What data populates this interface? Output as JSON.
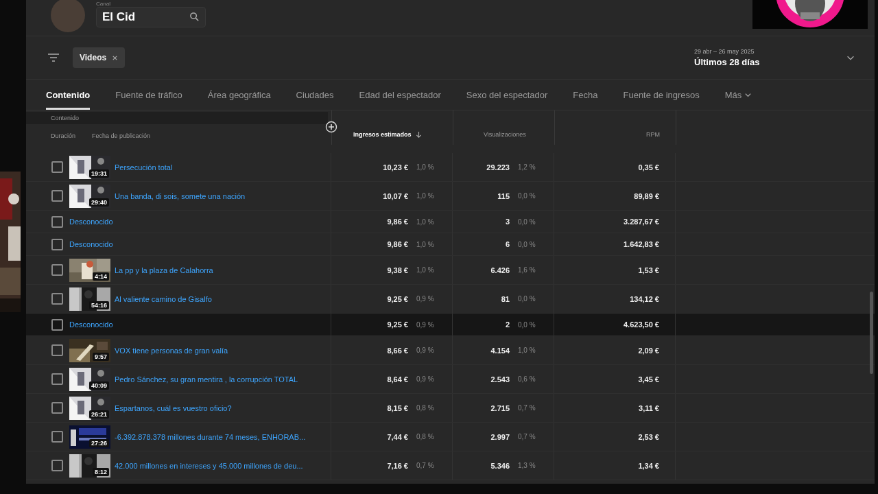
{
  "channel": {
    "label": "Canal",
    "value": "El Cid"
  },
  "filter": {
    "chips": [
      {
        "label": "Videos"
      }
    ]
  },
  "date_range": {
    "range": "29 abr – 26 may 2025",
    "preset": "Últimos 28 días"
  },
  "tabs": [
    {
      "label": "Contenido",
      "selected": true
    },
    {
      "label": "Fuente de tráfico",
      "selected": false
    },
    {
      "label": "Área geográfica",
      "selected": false
    },
    {
      "label": "Ciudades",
      "selected": false
    },
    {
      "label": "Edad del espectador",
      "selected": false
    },
    {
      "label": "Sexo del espectador",
      "selected": false
    },
    {
      "label": "Fecha",
      "selected": false
    },
    {
      "label": "Fuente de ingresos",
      "selected": false
    },
    {
      "label": "Más",
      "selected": false
    }
  ],
  "table": {
    "group_label": "Contenido",
    "sub_columns": [
      "Duración",
      "Fecha de publicación"
    ],
    "columns": [
      {
        "label": "Ingresos estimados",
        "sorted": true
      },
      {
        "label": "Visualizaciones",
        "sorted": false
      },
      {
        "label": "RPM",
        "sorted": false
      }
    ],
    "rows": [
      {
        "title": "Persecución total",
        "duration": "19:31",
        "revenue": "10,23 €",
        "revenue_share": "1,0 %",
        "views": "29.223",
        "views_share": "1,2 %",
        "rpm": "0,35 €",
        "highlighted": false,
        "checked": false
      },
      {
        "title": "Una banda, di sois, somete una nación",
        "duration": "29:40",
        "revenue": "10,07 €",
        "revenue_share": "1,0 %",
        "views": "115",
        "views_share": "0,0 %",
        "rpm": "89,89 €",
        "highlighted": false,
        "checked": false
      },
      {
        "title": "Desconocido",
        "revenue": "9,86 €",
        "revenue_share": "1,0 %",
        "views": "3",
        "views_share": "0,0 %",
        "rpm": "3.287,67 €",
        "highlighted": false,
        "checked": false
      },
      {
        "title": "Desconocido",
        "revenue": "9,86 €",
        "revenue_share": "1,0 %",
        "views": "6",
        "views_share": "0,0 %",
        "rpm": "1.642,83 €",
        "highlighted": false,
        "checked": false
      },
      {
        "title": "La pp y la plaza de Calahorra",
        "duration": "4:14",
        "revenue": "9,38 €",
        "revenue_share": "1,0 %",
        "views": "6.426",
        "views_share": "1,6 %",
        "rpm": "1,53 €",
        "highlighted": false,
        "checked": false
      },
      {
        "title": "Al valiente camino de Gisalfo",
        "duration": "54:16",
        "revenue": "9,25 €",
        "revenue_share": "0,9 %",
        "views": "81",
        "views_share": "0,0 %",
        "rpm": "134,12 €",
        "highlighted": false,
        "checked": false
      },
      {
        "title": "Desconocido",
        "revenue": "9,25 €",
        "revenue_share": "0,9 %",
        "views": "2",
        "views_share": "0,0 %",
        "rpm": "4.623,50 €",
        "highlighted": true,
        "checked": false
      },
      {
        "title": "VOX tiene personas de gran valía",
        "duration": "9:57",
        "revenue": "8,66 €",
        "revenue_share": "0,9 %",
        "views": "4.154",
        "views_share": "1,0 %",
        "rpm": "2,09 €",
        "highlighted": false,
        "checked": false
      },
      {
        "title": "Pedro Sánchez, su gran mentira , la corrupción TOTAL",
        "duration": "40:09",
        "revenue": "8,64 €",
        "revenue_share": "0,9 %",
        "views": "2.543",
        "views_share": "0,6 %",
        "rpm": "3,45 €",
        "highlighted": false,
        "checked": false
      },
      {
        "title": "Espartanos, cuál es vuestro oficio?",
        "duration": "26:21",
        "revenue": "8,15 €",
        "revenue_share": "0,8 %",
        "views": "2.715",
        "views_share": "0,7 %",
        "rpm": "3,11 €",
        "highlighted": false,
        "checked": false
      },
      {
        "title": "-6.392.878.378 millones durante 74 meses, ENHORAB...",
        "duration": "27:26",
        "revenue": "7,44 €",
        "revenue_share": "0,8 %",
        "views": "2.997",
        "views_share": "0,7 %",
        "rpm": "2,53 €",
        "highlighted": false,
        "checked": false
      },
      {
        "title": "42.000 millones en intereses y 45.000 millones de deu...",
        "duration": "8:12",
        "revenue": "7,16 €",
        "revenue_share": "0,7 %",
        "views": "5.346",
        "views_share": "1,3 %",
        "rpm": "1,34 €",
        "highlighted": false,
        "checked": false
      }
    ]
  }
}
